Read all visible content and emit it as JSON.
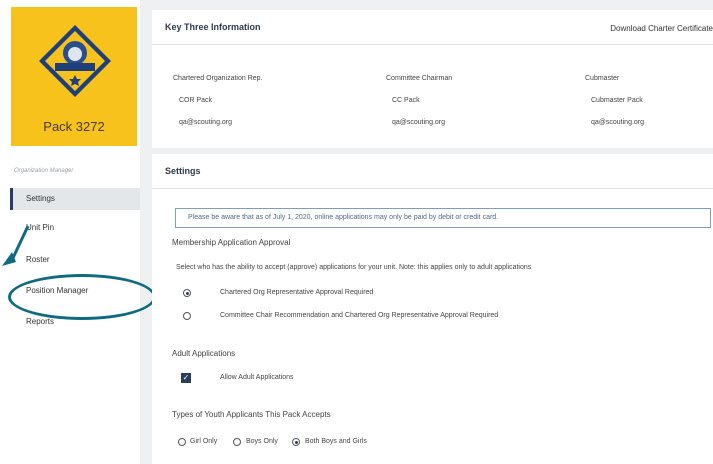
{
  "sidebar": {
    "pack_name": "Pack 3272",
    "org_label": "Organization Manager",
    "items": [
      {
        "label": "Settings"
      },
      {
        "label": "Unit Pin"
      },
      {
        "label": "Roster"
      },
      {
        "label": "Position Manager"
      },
      {
        "label": "Reports"
      }
    ],
    "active": "Settings",
    "annotation_color": "#0f6b80"
  },
  "key_three": {
    "title": "Key Three Information",
    "download_label": "Download Charter Certificate",
    "columns": [
      {
        "role": "Chartered Organization Rep.",
        "name": "COR Pack",
        "email": "qa@scouting.org"
      },
      {
        "role": "Committee Chairman",
        "name": "CC Pack",
        "email": "qa@scouting.org"
      },
      {
        "role": "Cubmaster",
        "name": "Cubmaster Pack",
        "email": "qa@scouting.org"
      }
    ]
  },
  "settings": {
    "title": "Settings",
    "notice": "Please be aware that as of July 1, 2020, online applications may only be paid by debit or credit card.",
    "membership_title": "Membership Application Approval",
    "membership_desc": "Select who has the ability to accept (approve) applications for your unit. Note: this applies only to adult applications",
    "approval_options": [
      {
        "label": "Chartered Org Representative Approval Required",
        "selected": true
      },
      {
        "label": "Committee Chair Recommendation and Chartered Org Representative Approval Required",
        "selected": false
      }
    ],
    "adult_title": "Adult Applications",
    "adult_checkbox": {
      "label": "Allow Adult Applications",
      "checked": true
    },
    "youth_title": "Types of Youth Applicants This Pack Accepts",
    "youth_options": [
      {
        "label": "Girl Only",
        "selected": false
      },
      {
        "label": "Boys Only",
        "selected": false
      },
      {
        "label": "Both Boys and Girls",
        "selected": true
      }
    ]
  },
  "colors": {
    "brand_yellow": "#f6c21b",
    "navy": "#2a3e5c",
    "notice_border": "#7aa0bf"
  }
}
